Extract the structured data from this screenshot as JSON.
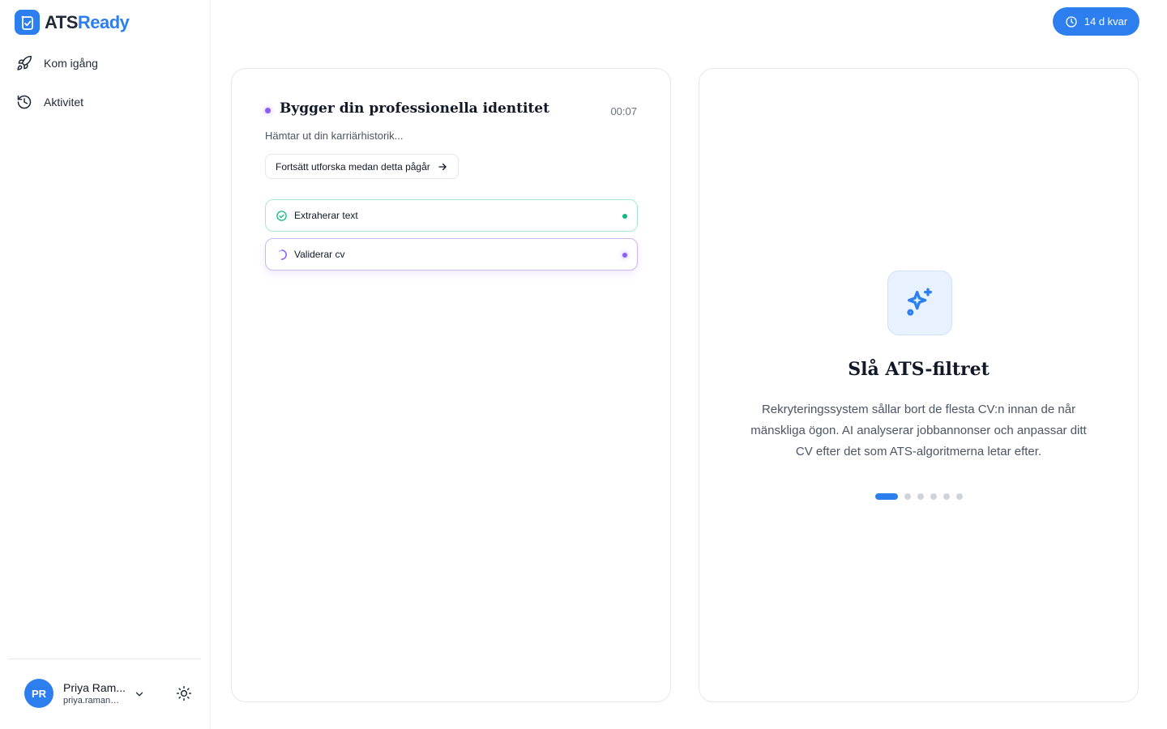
{
  "app": {
    "brand_part1": "ATS",
    "brand_part2": "Ready",
    "accent_color": "#2d7ff0"
  },
  "sidebar": {
    "items": [
      {
        "label": "Kom igång",
        "icon": "rocket-icon"
      },
      {
        "label": "Aktivitet",
        "icon": "history-icon"
      }
    ],
    "user": {
      "initials": "PR",
      "name": "Priya Ram...",
      "email": "priya.raman@..."
    }
  },
  "header": {
    "trial_label": "14 d kvar"
  },
  "progress": {
    "title": "Bygger din professionella identitet",
    "timer": "00:07",
    "subtitle": "Hämtar ut din karriärhistorik...",
    "explore_label": "Fortsätt utforska medan detta pågår",
    "steps": [
      {
        "label": "Extraherar text",
        "state": "done",
        "color": "#10b981"
      },
      {
        "label": "Validerar cv",
        "state": "in-progress",
        "color": "#8b5cf6"
      }
    ]
  },
  "feature": {
    "title": "Slå ATS-filtret",
    "description": "Rekryteringssystem sållar bort de flesta CV:n innan de når mänskliga ögon. AI analyserar jobbannonser och anpassar ditt CV efter det som ATS-algoritmerna letar efter.",
    "icon": "sparkles-icon",
    "carousel_active_index": 0,
    "carousel_count": 6
  }
}
